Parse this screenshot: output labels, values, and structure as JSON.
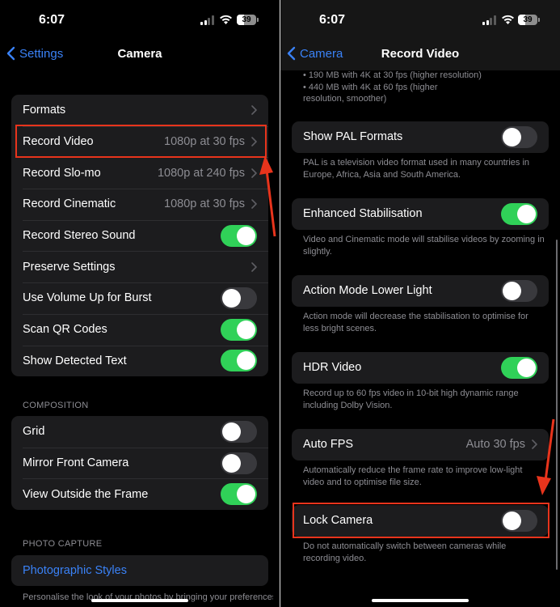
{
  "status_bar": {
    "time": "6:07",
    "battery": "39",
    "battery_level": 0.39,
    "signal_bars_active": 2,
    "signal_bars_total": 4
  },
  "left": {
    "back_label": "Settings",
    "title": "Camera",
    "main_rows": [
      {
        "label": "Formats",
        "type": "link"
      },
      {
        "label": "Record Video",
        "value": "1080p at 30 fps",
        "type": "link",
        "highlighted": true
      },
      {
        "label": "Record Slo-mo",
        "value": "1080p at 240 fps",
        "type": "link"
      },
      {
        "label": "Record Cinematic",
        "value": "1080p at 30 fps",
        "type": "link"
      },
      {
        "label": "Record Stereo Sound",
        "type": "toggle",
        "on": true
      },
      {
        "label": "Preserve Settings",
        "type": "link"
      },
      {
        "label": "Use Volume Up for Burst",
        "type": "toggle",
        "on": false
      },
      {
        "label": "Scan QR Codes",
        "type": "toggle",
        "on": true
      },
      {
        "label": "Show Detected Text",
        "type": "toggle",
        "on": true
      }
    ],
    "composition_header": "COMPOSITION",
    "composition_rows": [
      {
        "label": "Grid",
        "type": "toggle",
        "on": false
      },
      {
        "label": "Mirror Front Camera",
        "type": "toggle",
        "on": false
      },
      {
        "label": "View Outside the Frame",
        "type": "toggle",
        "on": true
      }
    ],
    "photo_capture_header": "PHOTO CAPTURE",
    "photographic_styles_label": "Photographic Styles",
    "photographic_styles_footnote": "Personalise the look of your photos by bringing your preferences into the capture. Photographic Styles use"
  },
  "right": {
    "back_label": "Camera",
    "title": "Record Video",
    "top_footnote_lines": [
      "• 190 MB with 4K at 30 fps (higher resolution)",
      "• 440 MB with 4K at 60 fps (higher",
      "resolution, smoother)"
    ],
    "settings": [
      {
        "label": "Show PAL Formats",
        "type": "toggle",
        "on": false,
        "footnote": "PAL is a television video format used in many countries in Europe, Africa, Asia and South America."
      },
      {
        "label": "Enhanced Stabilisation",
        "type": "toggle",
        "on": true,
        "footnote": "Video and Cinematic mode will stabilise videos by zooming in slightly."
      },
      {
        "label": "Action Mode Lower Light",
        "type": "toggle",
        "on": false,
        "footnote": "Action mode will decrease the stabilisation to optimise for less bright scenes."
      },
      {
        "label": "HDR Video",
        "type": "toggle",
        "on": true,
        "footnote": "Record up to 60 fps video in 10-bit high dynamic range including Dolby Vision."
      },
      {
        "label": "Auto FPS",
        "type": "link",
        "value": "Auto 30 fps",
        "footnote": "Automatically reduce the frame rate to improve low-light video and to optimise file size."
      },
      {
        "label": "Lock Camera",
        "type": "toggle",
        "on": false,
        "highlighted": true,
        "footnote": "Do not automatically switch between cameras while recording video."
      }
    ]
  },
  "colors": {
    "accent_blue": "#3a82f7",
    "toggle_on": "#30d158",
    "toggle_off": "#39393d",
    "annotation_red": "#e8341c",
    "cell_bg": "#1c1c1e"
  }
}
